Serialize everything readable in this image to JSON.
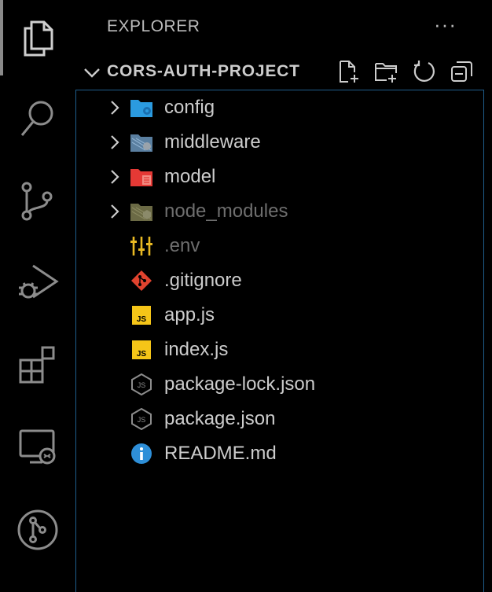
{
  "sidebar": {
    "title": "EXPLORER",
    "more_actions": "···",
    "section_title": "CORS-AUTH-PROJECT"
  },
  "tree": {
    "items": [
      {
        "label": "config",
        "kind": "folder",
        "icon": "folder-config-icon",
        "dim": false
      },
      {
        "label": "middleware",
        "kind": "folder",
        "icon": "folder-middleware-icon",
        "dim": false
      },
      {
        "label": "model",
        "kind": "folder",
        "icon": "folder-model-icon",
        "dim": false
      },
      {
        "label": "node_modules",
        "kind": "folder",
        "icon": "folder-node-icon",
        "dim": true
      },
      {
        "label": ".env",
        "kind": "file",
        "icon": "env-file-icon",
        "dim": true
      },
      {
        "label": ".gitignore",
        "kind": "file",
        "icon": "git-file-icon",
        "dim": false
      },
      {
        "label": "app.js",
        "kind": "file",
        "icon": "js-file-icon",
        "dim": false
      },
      {
        "label": "index.js",
        "kind": "file",
        "icon": "js-file-icon",
        "dim": false
      },
      {
        "label": "package-lock.json",
        "kind": "file",
        "icon": "nodejs-file-icon",
        "dim": false
      },
      {
        "label": "package.json",
        "kind": "file",
        "icon": "nodejs-file-icon",
        "dim": false
      },
      {
        "label": "README.md",
        "kind": "file",
        "icon": "info-file-icon",
        "dim": false
      }
    ]
  },
  "colors": {
    "accent_border": "#1f5e8c",
    "folder_config": "#2b9be0",
    "folder_model": "#e53935",
    "js_yellow": "#f5c518",
    "git_red": "#e0432e",
    "env_yellow": "#e8b923",
    "info_blue": "#2e8fd8"
  }
}
